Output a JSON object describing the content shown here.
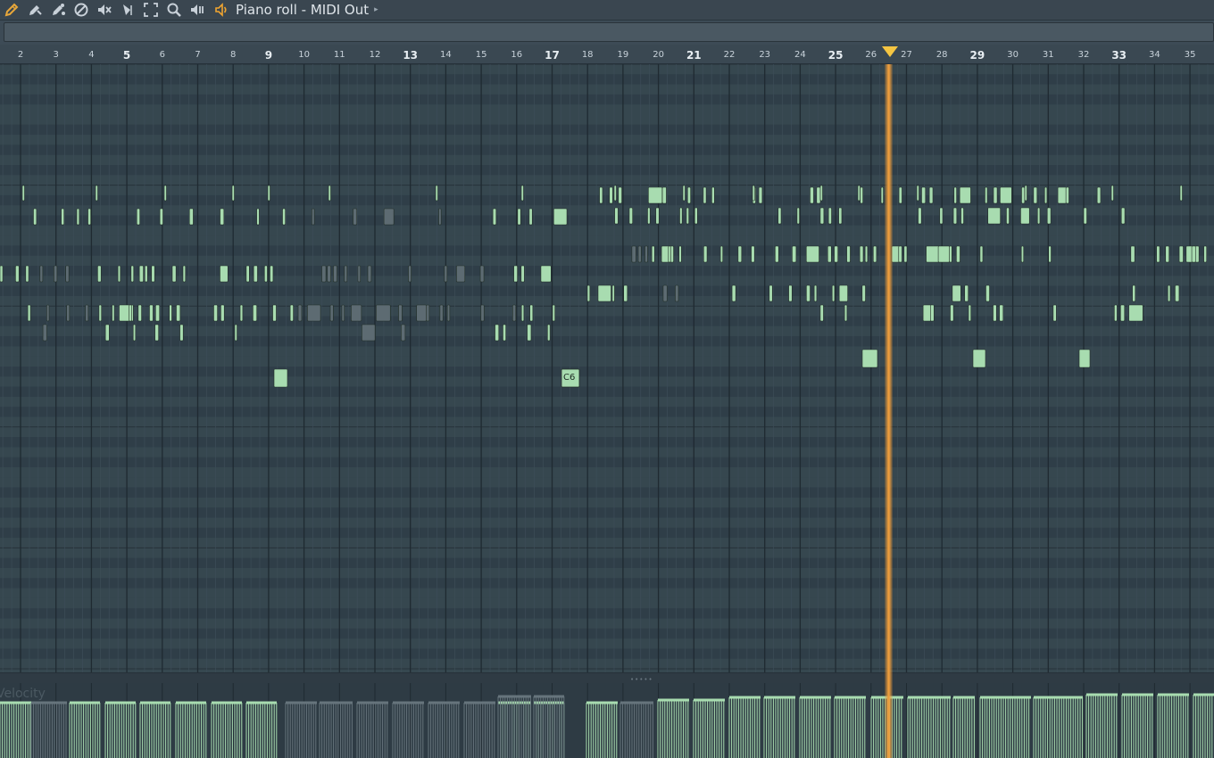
{
  "window": {
    "title": "Piano roll - MIDI Out",
    "menu_arrow": "▸"
  },
  "toolbar": {
    "tools": [
      {
        "name": "draw-tool-icon",
        "color": "#e8a73a"
      },
      {
        "name": "paint-tool-icon",
        "color": "#c8d0d8"
      },
      {
        "name": "paint-drums-tool-icon",
        "color": "#c8d0d8"
      },
      {
        "name": "delete-tool-icon",
        "color": "#c8d0d8"
      },
      {
        "name": "mute-tool-icon",
        "color": "#c8d0d8"
      },
      {
        "name": "slice-tool-icon",
        "color": "#c8d0d8"
      },
      {
        "name": "select-tool-icon",
        "color": "#c8d0d8"
      },
      {
        "name": "zoom-tool-icon",
        "color": "#c8d0d8"
      },
      {
        "name": "playback-tool-icon",
        "color": "#c8d0d8"
      }
    ],
    "speaker_color": "#f0a530"
  },
  "ruler": {
    "bars": [
      "2",
      "3",
      "4",
      "5",
      "6",
      "7",
      "8",
      "9",
      "10",
      "11",
      "12",
      "13",
      "14",
      "15",
      "16",
      "17",
      "18",
      "19",
      "20",
      "21",
      "22",
      "23",
      "24",
      "25",
      "26",
      "27",
      "28",
      "29",
      "30",
      "31",
      "32",
      "33",
      "34",
      "35"
    ],
    "major_bars": [
      "5",
      "9",
      "13",
      "17",
      "21",
      "25",
      "29",
      "33"
    ]
  },
  "notes": {
    "labels": [
      "C6"
    ],
    "color": "#a8dcb0",
    "ghost_color": "#5d6b72"
  },
  "velocity": {
    "label": "Velocity"
  },
  "colors": {
    "playhead": "#f0a040",
    "playhead_marker": "#f4c542",
    "grid_bg": "#34444f"
  }
}
